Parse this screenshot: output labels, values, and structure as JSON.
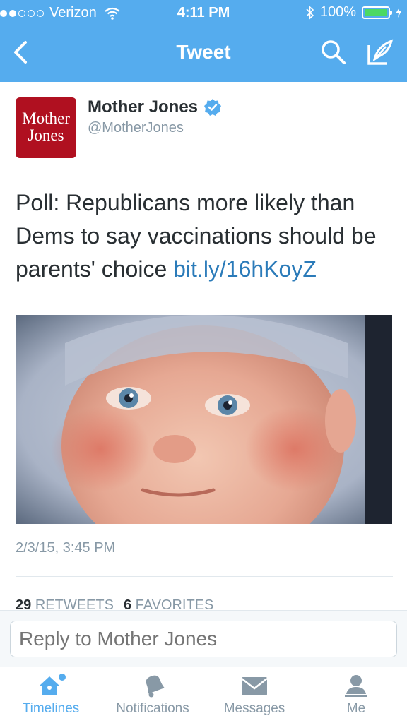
{
  "status_bar": {
    "carrier": "Verizon",
    "time": "4:11 PM",
    "battery": "100%",
    "battery_level": 1.0,
    "signal_bars_filled": 2,
    "signal_bars_total": 5
  },
  "nav": {
    "title": "Tweet",
    "icons": [
      "back-chevron-icon",
      "search-icon",
      "compose-icon"
    ]
  },
  "tweet": {
    "avatar_text": "Mother Jones",
    "author_name": "Mother Jones",
    "verified": true,
    "handle": "@MotherJones",
    "text": "Poll: Republicans more likely than Dems to say vaccinations should be parents' choice",
    "link": "bit.ly/16hKoyZ",
    "timestamp": "2/3/15, 3:45 PM",
    "retweets_count": "29",
    "retweets_label": "RETWEETS",
    "favorites_count": "6",
    "favorites_label": "FAVORITES"
  },
  "reply": {
    "placeholder": "Reply to Mother Jones"
  },
  "tabbar": {
    "tabs": [
      {
        "label": "Timelines",
        "icon": "home-icon",
        "active": true
      },
      {
        "label": "Notifications",
        "icon": "bell-icon",
        "active": false
      },
      {
        "label": "Messages",
        "icon": "envelope-icon",
        "active": false
      },
      {
        "label": "Me",
        "icon": "person-icon",
        "active": false
      }
    ]
  },
  "colors": {
    "brand": "#55acee",
    "link": "#2b7bb9",
    "avatar_bg": "#b01020",
    "battery_fill": "#4cd964"
  }
}
